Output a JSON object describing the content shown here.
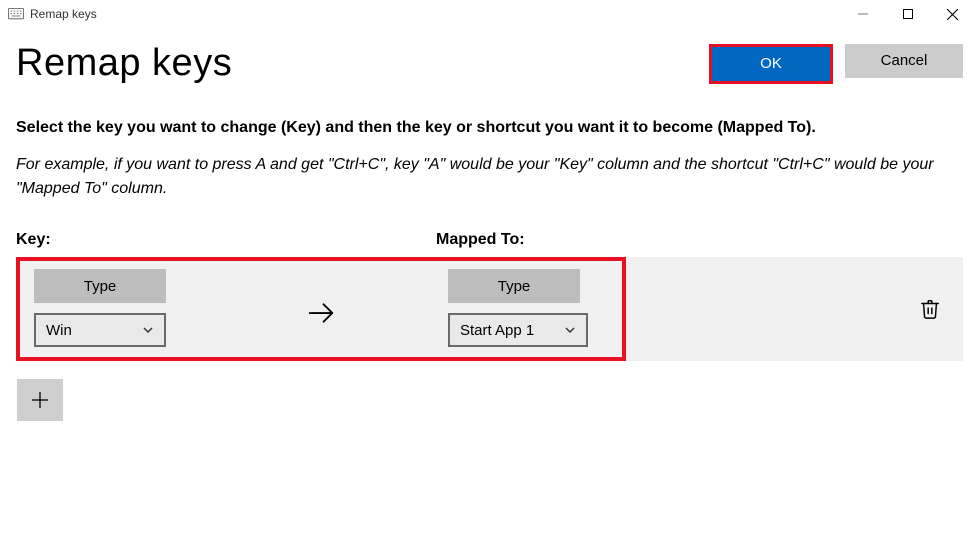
{
  "window": {
    "title": "Remap keys"
  },
  "header": {
    "page_title": "Remap keys",
    "ok_label": "OK",
    "cancel_label": "Cancel"
  },
  "instructions": {
    "bold": "Select the key you want to change (Key) and then the key or shortcut you want it to become (Mapped To).",
    "italic": "For example, if you want to press A and get \"Ctrl+C\", key \"A\" would be your \"Key\" column and the shortcut \"Ctrl+C\" would be your \"Mapped To\" column."
  },
  "columns": {
    "key_label": "Key:",
    "mapped_label": "Mapped To:"
  },
  "mapping": {
    "type_label": "Type",
    "key_selected": "Win",
    "mapped_selected": "Start App 1"
  }
}
